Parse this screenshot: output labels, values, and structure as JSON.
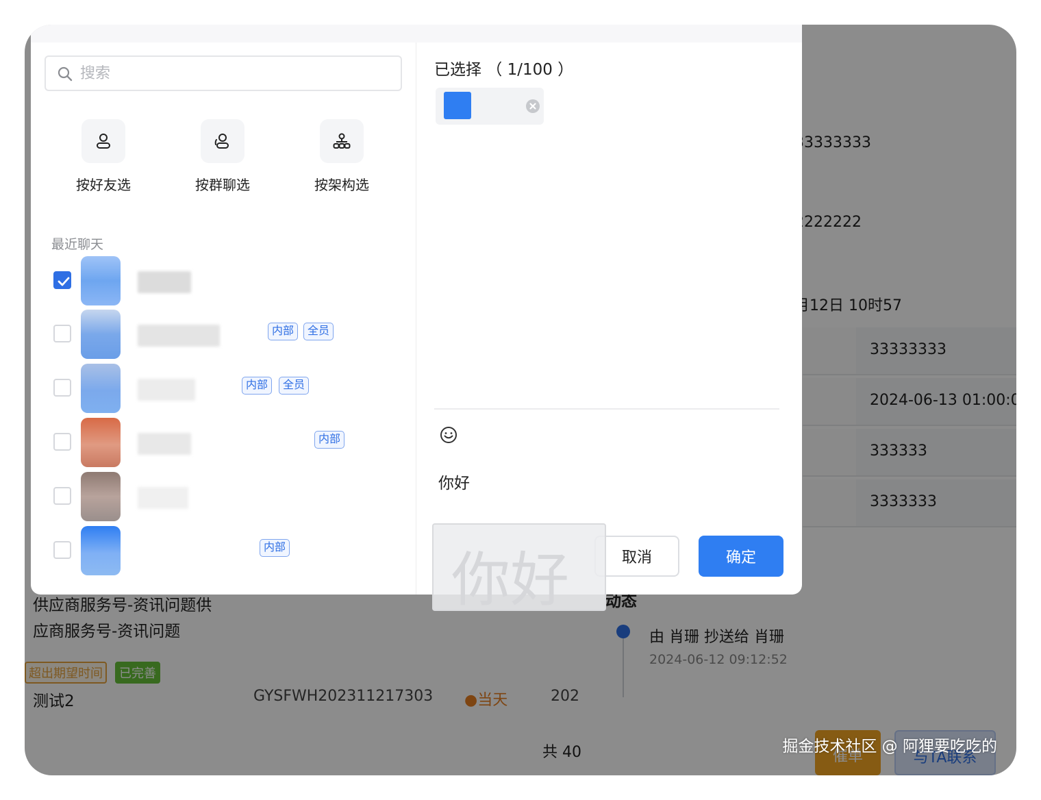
{
  "background": {
    "right_values": [
      "33333333",
      "2222222",
      "月12日 10时57"
    ],
    "table_cells": [
      "33333333",
      "2024-06-13 01:00:0",
      "333333",
      "3333333"
    ],
    "left_lines": [
      "供应商服务号-资讯问题供",
      "应商服务号-资讯问题"
    ],
    "tag_overdue": "超出期望时间",
    "tag_done": "已完善",
    "row_name": "测试2",
    "row_code": "GYSFWH202311217303",
    "row_status": "●当天",
    "row_date": "202",
    "total": "共 40",
    "activity_title": "动态",
    "activity_text": "由 肖珊 抄送给 肖珊",
    "activity_time": "2024-06-12 09:12:52",
    "urge_button": "催单",
    "contact_button": "与TA联系"
  },
  "dialog": {
    "search": {
      "placeholder": "搜索"
    },
    "modes": [
      {
        "label": "按好友选",
        "icon": "user-icon"
      },
      {
        "label": "按群聊选",
        "icon": "group-icon"
      },
      {
        "label": "按架构选",
        "icon": "org-structure-icon"
      }
    ],
    "recent_title": "最近聊天",
    "contacts": [
      {
        "checked": true,
        "badges": []
      },
      {
        "checked": false,
        "badges": [
          "内部",
          "全员"
        ]
      },
      {
        "checked": false,
        "badges": [
          "内部",
          "全员"
        ]
      },
      {
        "checked": false,
        "badges": [
          "内部"
        ]
      },
      {
        "checked": false,
        "badges": []
      },
      {
        "checked": false,
        "badges": [
          "内部"
        ]
      }
    ],
    "selected_title": "已选择 （ 1/100 ）",
    "message": "你好",
    "cancel": "取消",
    "confirm": "确定",
    "drag_preview": "你好"
  },
  "colors": {
    "primary": "#2f7ef2",
    "overdue": "#e6a23c",
    "done": "#67c23a"
  },
  "watermark": "掘金技术社区 @ 阿狸要吃吃的"
}
